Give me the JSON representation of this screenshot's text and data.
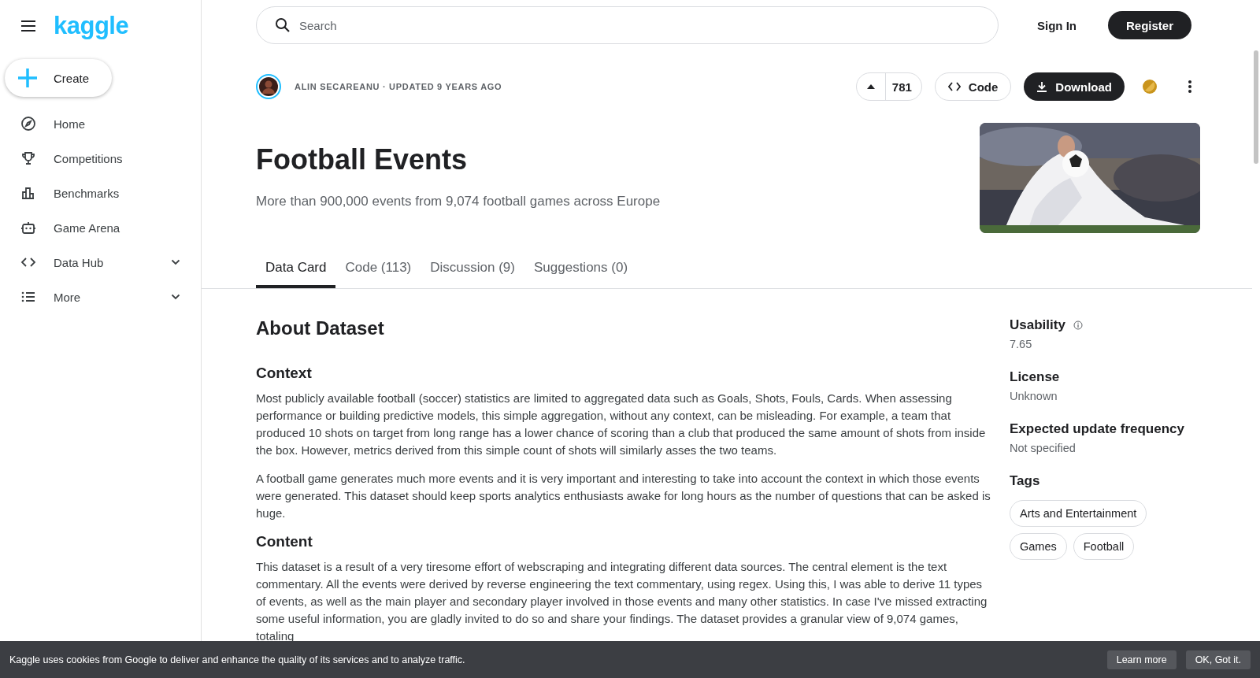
{
  "sidebar": {
    "logo": "kaggle",
    "create_button": "Create",
    "items": [
      {
        "label": "Home",
        "expandable": false
      },
      {
        "label": "Competitions",
        "expandable": false
      },
      {
        "label": "Benchmarks",
        "expandable": false
      },
      {
        "label": "Game Arena",
        "expandable": false
      },
      {
        "label": "Data Hub",
        "expandable": true
      },
      {
        "label": "More",
        "expandable": true
      }
    ]
  },
  "header": {
    "search": {
      "placeholder": "Search"
    },
    "sign_in": "Sign In",
    "register": "Register"
  },
  "dataset": {
    "byline": "ALIN SECAREANU · UPDATED 9 YEARS AGO",
    "votes": "781",
    "code_button": "Code",
    "download_button": "Download",
    "title": "Football Events",
    "subtitle": "More than 900,000 events from 9,074 football games across Europe"
  },
  "tabs": [
    {
      "label": "Data Card",
      "selected": true
    },
    {
      "label": "Code (113)",
      "selected": false
    },
    {
      "label": "Discussion (9)",
      "selected": false
    },
    {
      "label": "Suggestions (0)",
      "selected": false
    }
  ],
  "about": {
    "heading": "About Dataset",
    "sections": [
      {
        "heading": "Context",
        "paragraphs": [
          "Most publicly available football (soccer) statistics are limited to aggregated data such as Goals, Shots, Fouls, Cards. When assessing performance or building predictive models, this simple aggregation, without any context, can be misleading. For example, a team that produced 10 shots on target from long range has a lower chance of scoring than a club that produced the same amount of shots from inside the box. However, metrics derived from this simple count of shots will similarly asses the two teams.",
          "A football game generates much more events and it is very important and interesting to take into account the context in which those events were generated. This dataset should keep sports analytics enthusiasts awake for long hours as the number of questions that can be asked is huge."
        ]
      },
      {
        "heading": "Content",
        "paragraphs": [
          "This dataset is a result of a very tiresome effort of webscraping and integrating different data sources. The central element is the text commentary. All the events were derived by reverse engineering the text commentary, using regex. Using this, I was able to derive 11 types of events, as well as the main player and secondary player involved in those events and many other statistics. In case I've missed extracting some useful information, you are gladly invited to do so and share your findings. The dataset provides a granular view of 9,074 games, totaling"
        ]
      }
    ]
  },
  "metadata": [
    {
      "label": "Usability",
      "value": "7.65",
      "info": true
    },
    {
      "label": "License",
      "value": "Unknown",
      "info": false
    },
    {
      "label": "Expected update frequency",
      "value": "Not specified",
      "info": false
    }
  ],
  "tags": {
    "heading": "Tags",
    "items": [
      "Arts and Entertainment",
      "Games",
      "Football"
    ]
  },
  "cookie_bar": {
    "text": "Kaggle uses cookies from Google to deliver and enhance the quality of its services and to analyze traffic.",
    "buttons": [
      "Learn more",
      "OK, Got it."
    ]
  }
}
